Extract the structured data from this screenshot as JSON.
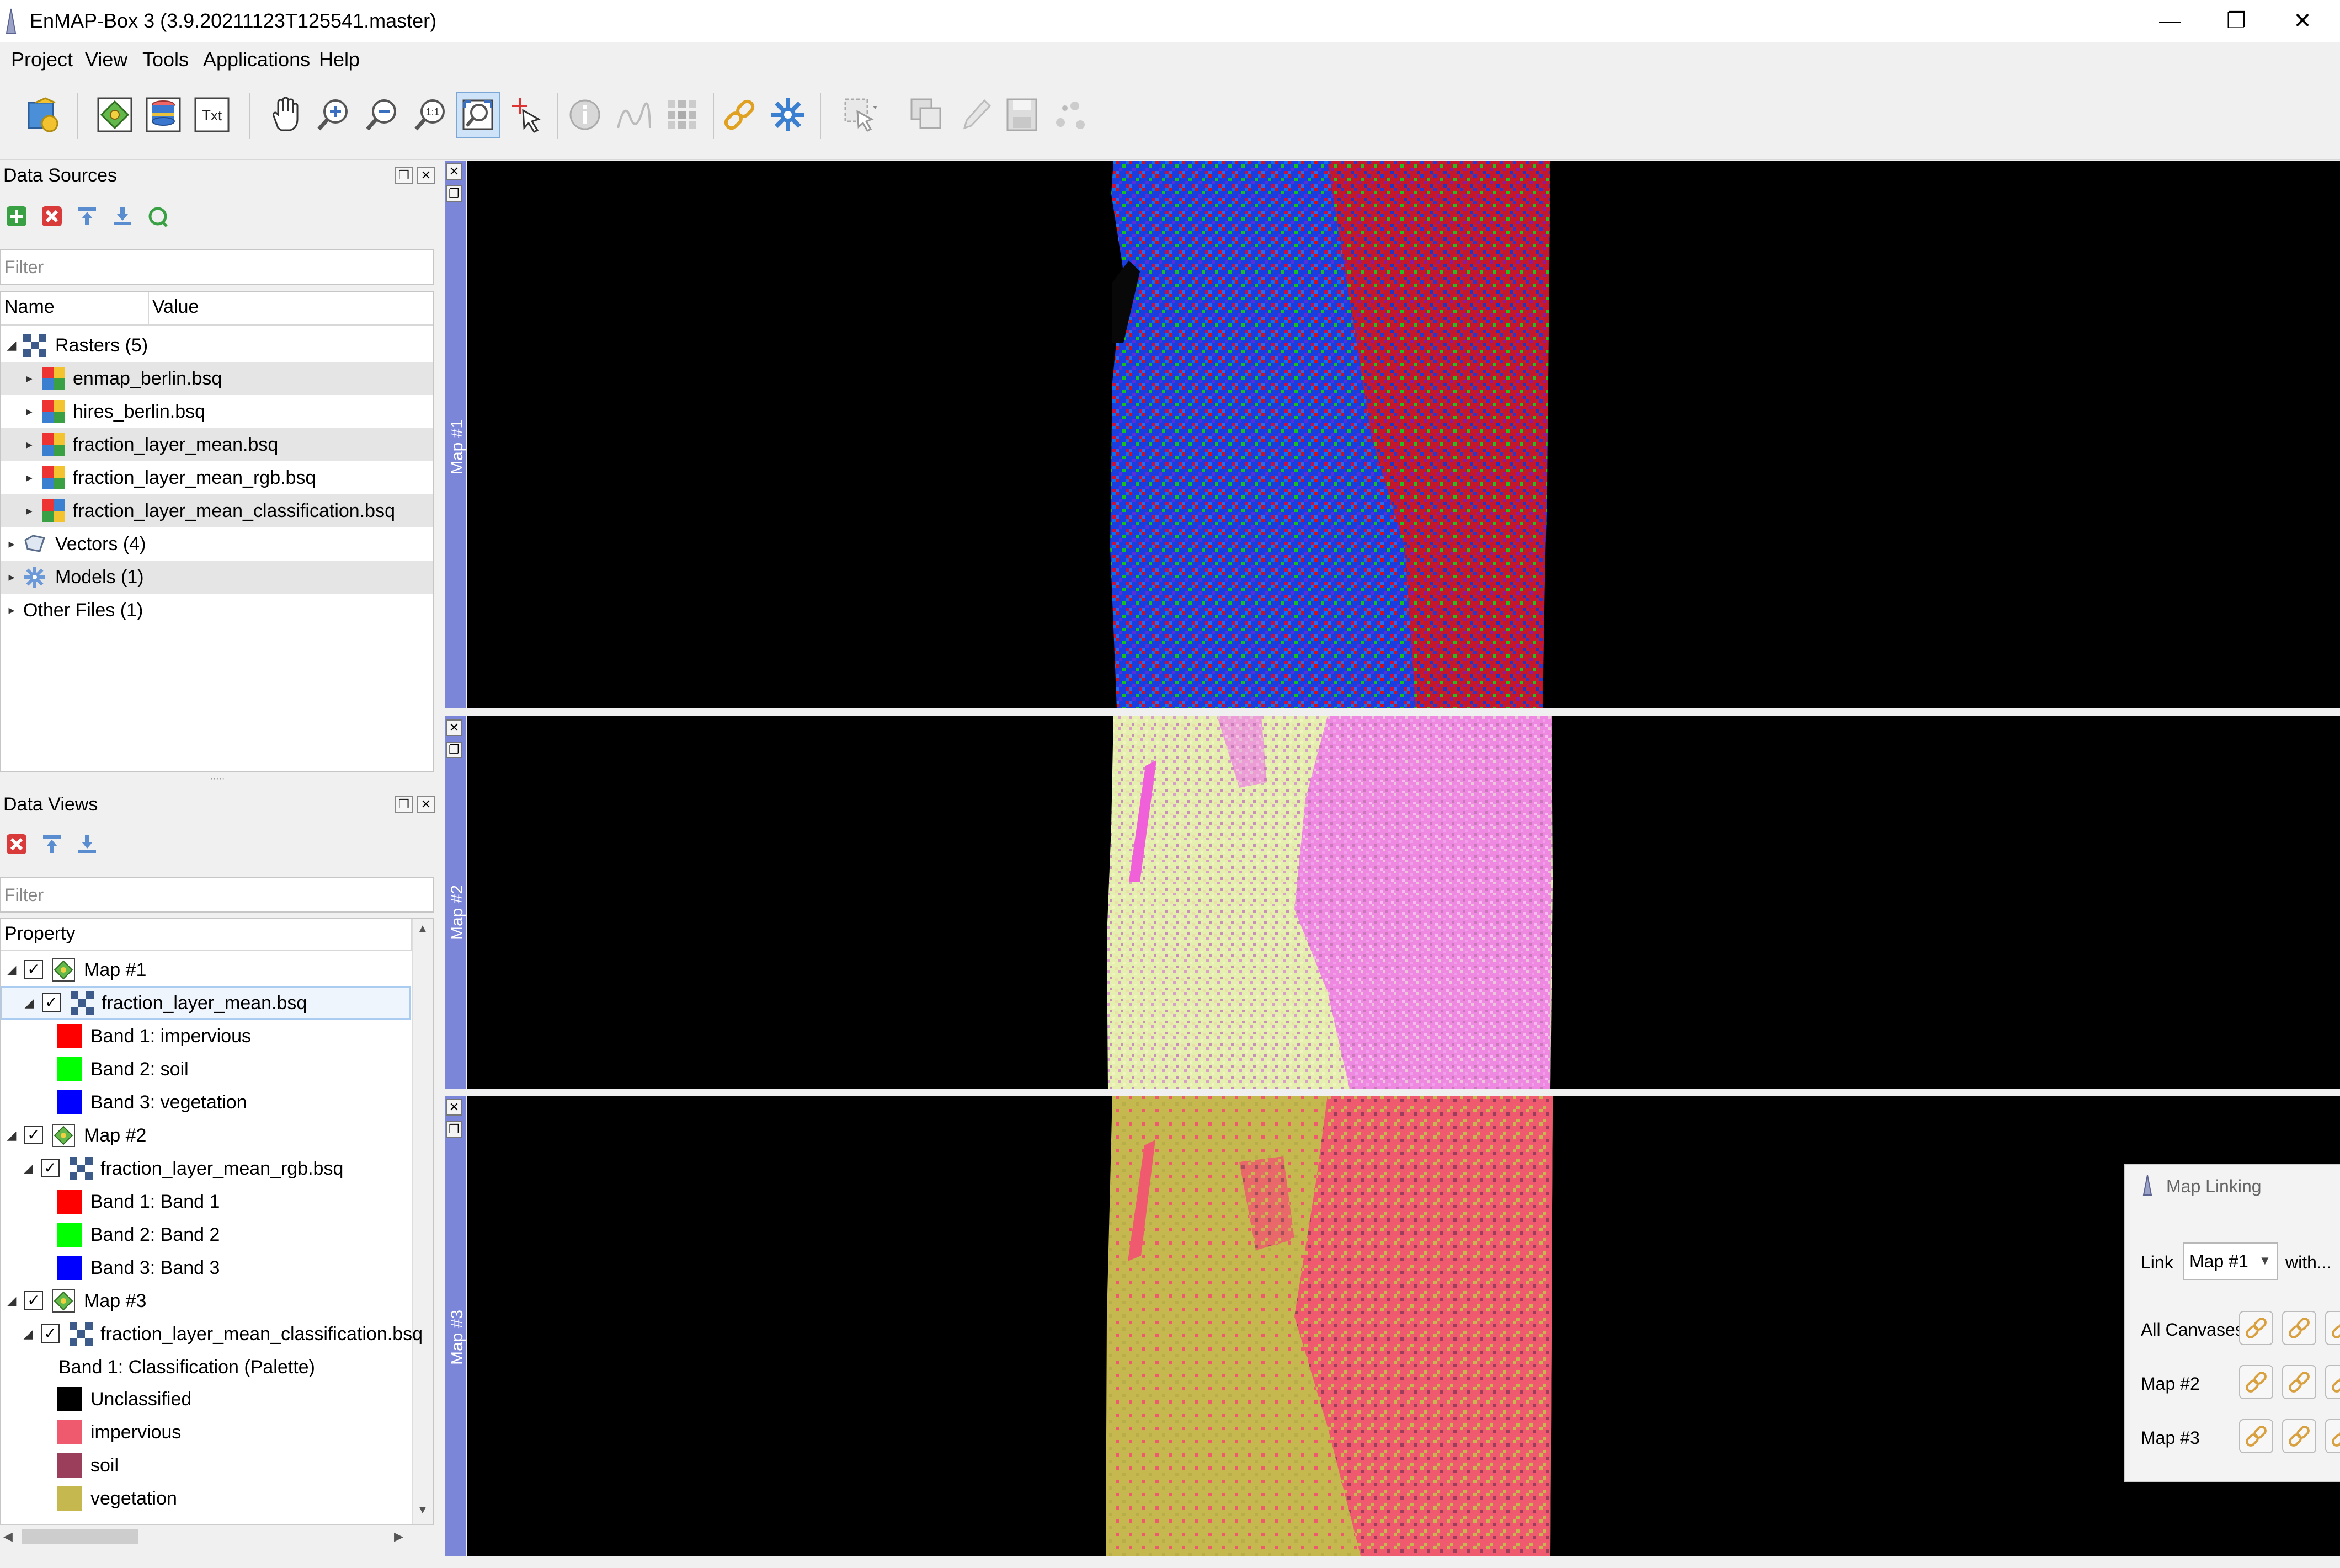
{
  "window": {
    "title": "EnMAP-Box 3 (3.9.20211123T125541.master)",
    "minimize": "—",
    "restore": "❐",
    "close": "✕"
  },
  "menu": [
    "Project",
    "View",
    "Tools",
    "Applications",
    "Help"
  ],
  "toolbar": {
    "buttons": [
      "open-data-source-icon",
      "add-map-view-icon",
      "add-spectral-library-icon",
      "add-text-view-icon",
      "pan-icon",
      "zoom-in-icon",
      "zoom-out-icon",
      "zoom-native-icon",
      "zoom-full-extent-icon",
      "select-cursor-location-icon",
      "identify-info-icon",
      "spectral-profile-icon",
      "pixel-grid-icon",
      "map-linking-icon",
      "settings-gear-icon",
      "select-features-icon",
      "deselect-features-icon",
      "edit-pencil-icon",
      "save-edits-icon",
      "digitize-points-icon"
    ],
    "text_button_label": "Txt"
  },
  "data_sources": {
    "title": "Data Sources",
    "filter_placeholder": "Filter",
    "columns": [
      "Name",
      "Value"
    ],
    "tree": [
      {
        "label": "Rasters (5)",
        "icon": "raster-group-icon"
      },
      {
        "label": "enmap_berlin.bsq",
        "icon": "raster-file-icon"
      },
      {
        "label": "hires_berlin.bsq",
        "icon": "raster-file-icon"
      },
      {
        "label": "fraction_layer_mean.bsq",
        "icon": "raster-file-icon"
      },
      {
        "label": "fraction_layer_mean_rgb.bsq",
        "icon": "raster-file-icon"
      },
      {
        "label": "fraction_layer_mean_classification.bsq",
        "icon": "raster-file-icon"
      },
      {
        "label": "Vectors (4)",
        "icon": "vector-group-icon"
      },
      {
        "label": "Models (1)",
        "icon": "model-group-icon"
      },
      {
        "label": "Other Files (1)",
        "icon": ""
      }
    ]
  },
  "data_views": {
    "title": "Data Views",
    "filter_placeholder": "Filter",
    "column": "Property",
    "maps": [
      {
        "name": "Map #1",
        "layer": "fraction_layer_mean.bsq",
        "bands": [
          {
            "label": "Band 1: impervious",
            "color": "#ff0000"
          },
          {
            "label": "Band 2: soil",
            "color": "#00ff00"
          },
          {
            "label": "Band 3: vegetation",
            "color": "#0000ff"
          }
        ]
      },
      {
        "name": "Map #2",
        "layer": "fraction_layer_mean_rgb.bsq",
        "bands": [
          {
            "label": "Band 1: Band 1",
            "color": "#ff0000"
          },
          {
            "label": "Band 2: Band 2",
            "color": "#00ff00"
          },
          {
            "label": "Band 3: Band 3",
            "color": "#0000ff"
          }
        ]
      },
      {
        "name": "Map #3",
        "layer": "fraction_layer_mean_classification.bsq",
        "renderer": "Band 1: Classification (Palette)",
        "classes": [
          {
            "label": "Unclassified",
            "color": "#000000"
          },
          {
            "label": "impervious",
            "color": "#f05a6e"
          },
          {
            "label": "soil",
            "color": "#9a3e5c"
          },
          {
            "label": "vegetation",
            "color": "#c4b84f"
          }
        ]
      }
    ]
  },
  "map_panels": [
    {
      "label": "Map #1"
    },
    {
      "label": "Map #2"
    },
    {
      "label": "Map #3"
    }
  ],
  "map_linking": {
    "title": "Map Linking",
    "link_label": "Link",
    "selected_map": "Map #1",
    "with_label": "with...",
    "rows": [
      "All Canvases",
      "Map #2",
      "Map #3"
    ]
  },
  "colors": {
    "map_sidebar": "#7b86d9",
    "selection": "#e5e5e5"
  }
}
